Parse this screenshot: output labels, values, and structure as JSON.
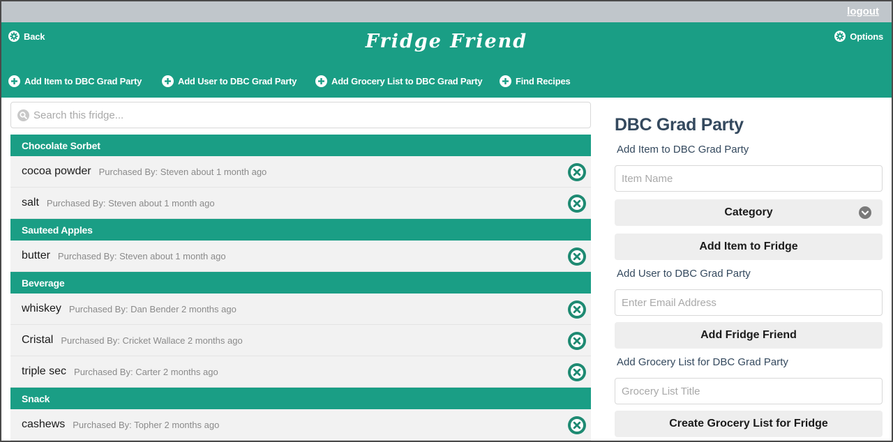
{
  "topbar": {
    "logout_label": "logout"
  },
  "header": {
    "title": "Fridge Friend",
    "back_label": "Back",
    "options_label": "Options",
    "actions": [
      "Add Item to DBC Grad Party",
      "Add User to DBC Grad Party",
      "Add Grocery List to DBC Grad Party",
      "Find Recipes"
    ]
  },
  "search": {
    "placeholder": "Search this fridge..."
  },
  "groups": [
    {
      "category": "Chocolate Sorbet",
      "items": [
        {
          "name": "cocoa powder",
          "meta": "Purchased By: Steven about 1 month ago"
        },
        {
          "name": "salt",
          "meta": "Purchased By: Steven about 1 month ago"
        }
      ]
    },
    {
      "category": "Sauteed Apples",
      "items": [
        {
          "name": "butter",
          "meta": "Purchased By: Steven about 1 month ago"
        }
      ]
    },
    {
      "category": "Beverage",
      "items": [
        {
          "name": "whiskey",
          "meta": "Purchased By: Dan Bender 2 months ago"
        },
        {
          "name": "Cristal",
          "meta": "Purchased By: Cricket Wallace 2 months ago"
        },
        {
          "name": "triple sec",
          "meta": "Purchased By: Carter 2 months ago"
        }
      ]
    },
    {
      "category": "Snack",
      "items": [
        {
          "name": "cashews",
          "meta": "Purchased By: Topher 2 months ago"
        }
      ]
    }
  ],
  "panel": {
    "title": "DBC Grad Party",
    "add_item_label": "Add Item to DBC Grad Party",
    "item_name_placeholder": "Item Name",
    "category_label": "Category",
    "add_item_button": "Add Item to Fridge",
    "add_user_label": "Add User to DBC Grad Party",
    "email_placeholder": "Enter Email Address",
    "add_user_button": "Add Fridge Friend",
    "add_list_label": "Add Grocery List for DBC Grad Party",
    "list_title_placeholder": "Grocery List Title",
    "add_list_button": "Create Grocery List for Fridge"
  },
  "colors": {
    "brand": "#1a9e85",
    "topbar": "#c0c6cb",
    "heading": "#34495e",
    "remove_button": "#1e8a72"
  },
  "icons": {
    "back": "gear-icon",
    "options": "gear-icon",
    "actions": "plus-circle-icon",
    "search": "search-icon",
    "remove": "close-circle-icon",
    "category": "chevron-down-icon"
  }
}
